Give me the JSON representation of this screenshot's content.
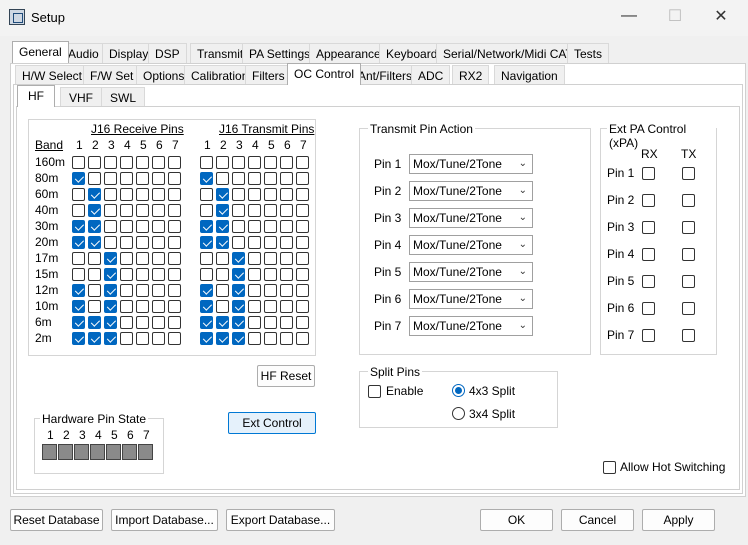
{
  "window": {
    "title": "Setup"
  },
  "main_tabs": [
    "General",
    "Audio",
    "Display",
    "DSP",
    "Transmit",
    "PA Settings",
    "Appearance",
    "Keyboard",
    "Serial/Network/Midi CAT",
    "Tests"
  ],
  "sub_tabs": [
    "H/W Select",
    "F/W Set",
    "Options",
    "Calibration",
    "Filters",
    "OC Control",
    "Ant/Filters",
    "ADC",
    "RX2",
    "Navigation"
  ],
  "band_tabs": [
    "HF",
    "VHF",
    "SWL"
  ],
  "oc": {
    "receive_title": "J16 Receive Pins",
    "transmit_title": "J16 Transmit Pins",
    "band_header": "Band",
    "pin_numbers": [
      "1",
      "2",
      "3",
      "4",
      "5",
      "6",
      "7"
    ],
    "bands": [
      {
        "name": "160m",
        "rx": [
          0,
          0,
          0,
          0,
          0,
          0,
          0
        ],
        "tx": [
          0,
          0,
          0,
          0,
          0,
          0,
          0
        ]
      },
      {
        "name": "80m",
        "rx": [
          1,
          0,
          0,
          0,
          0,
          0,
          0
        ],
        "tx": [
          1,
          0,
          0,
          0,
          0,
          0,
          0
        ]
      },
      {
        "name": "60m",
        "rx": [
          0,
          1,
          0,
          0,
          0,
          0,
          0
        ],
        "tx": [
          0,
          1,
          0,
          0,
          0,
          0,
          0
        ]
      },
      {
        "name": "40m",
        "rx": [
          0,
          1,
          0,
          0,
          0,
          0,
          0
        ],
        "tx": [
          0,
          1,
          0,
          0,
          0,
          0,
          0
        ]
      },
      {
        "name": "30m",
        "rx": [
          1,
          1,
          0,
          0,
          0,
          0,
          0
        ],
        "tx": [
          1,
          1,
          0,
          0,
          0,
          0,
          0
        ]
      },
      {
        "name": "20m",
        "rx": [
          1,
          1,
          0,
          0,
          0,
          0,
          0
        ],
        "tx": [
          1,
          1,
          0,
          0,
          0,
          0,
          0
        ]
      },
      {
        "name": "17m",
        "rx": [
          0,
          0,
          1,
          0,
          0,
          0,
          0
        ],
        "tx": [
          0,
          0,
          1,
          0,
          0,
          0,
          0
        ]
      },
      {
        "name": "15m",
        "rx": [
          0,
          0,
          1,
          0,
          0,
          0,
          0
        ],
        "tx": [
          0,
          0,
          1,
          0,
          0,
          0,
          0
        ]
      },
      {
        "name": "12m",
        "rx": [
          1,
          0,
          1,
          0,
          0,
          0,
          0
        ],
        "tx": [
          1,
          0,
          1,
          0,
          0,
          0,
          0
        ]
      },
      {
        "name": "10m",
        "rx": [
          1,
          0,
          1,
          0,
          0,
          0,
          0
        ],
        "tx": [
          1,
          0,
          1,
          0,
          0,
          0,
          0
        ]
      },
      {
        "name": "6m",
        "rx": [
          1,
          1,
          1,
          0,
          0,
          0,
          0
        ],
        "tx": [
          1,
          1,
          1,
          0,
          0,
          0,
          0
        ]
      },
      {
        "name": "2m",
        "rx": [
          1,
          1,
          1,
          0,
          0,
          0,
          0
        ],
        "tx": [
          1,
          1,
          1,
          0,
          0,
          0,
          0
        ]
      }
    ],
    "hf_reset": "HF Reset",
    "ext_control": "Ext Control"
  },
  "hardware_pin_state": {
    "title": "Hardware Pin State",
    "pins": [
      "1",
      "2",
      "3",
      "4",
      "5",
      "6",
      "7"
    ]
  },
  "transmit_pin_action": {
    "title": "Transmit Pin Action",
    "rows": [
      {
        "label": "Pin 1",
        "value": "Mox/Tune/2Tone"
      },
      {
        "label": "Pin 2",
        "value": "Mox/Tune/2Tone"
      },
      {
        "label": "Pin 3",
        "value": "Mox/Tune/2Tone"
      },
      {
        "label": "Pin 4",
        "value": "Mox/Tune/2Tone"
      },
      {
        "label": "Pin 5",
        "value": "Mox/Tune/2Tone"
      },
      {
        "label": "Pin 6",
        "value": "Mox/Tune/2Tone"
      },
      {
        "label": "Pin 7",
        "value": "Mox/Tune/2Tone"
      }
    ]
  },
  "ext_pa": {
    "title": "Ext PA Control (xPA)",
    "rx_label": "RX",
    "tx_label": "TX",
    "pins": [
      "Pin 1",
      "Pin 2",
      "Pin 3",
      "Pin 4",
      "Pin 5",
      "Pin 6",
      "Pin 7"
    ]
  },
  "split_pins": {
    "title": "Split Pins",
    "enable_label": "Enable",
    "enabled": false,
    "opt1": "4x3 Split",
    "opt2": "3x4 Split",
    "selected": "4x3 Split"
  },
  "allow_hot_switching": {
    "label": "Allow Hot Switching",
    "checked": false
  },
  "footer": {
    "reset": "Reset Database",
    "import": "Import Database...",
    "export": "Export Database...",
    "ok": "OK",
    "cancel": "Cancel",
    "apply": "Apply"
  },
  "colors": {
    "accent": "#0067c0",
    "face": "#f0f0f0",
    "ext_button": "#e5f1fb"
  }
}
